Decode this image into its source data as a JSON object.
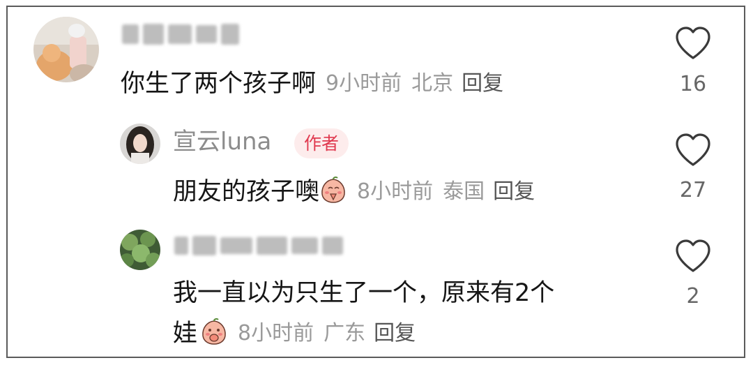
{
  "comments": [
    {
      "text": "你生了两个孩子啊",
      "time": "9小时前",
      "location": "北京",
      "reply_label": "回复",
      "likes": "16"
    },
    {
      "username": "宣云luna",
      "badge": "作者",
      "text": "朋友的孩子噢",
      "time": "8小时前",
      "location": "泰国",
      "reply_label": "回复",
      "likes": "27"
    },
    {
      "text_line1": "我一直以为只生了一个，原来有2个",
      "text_line2": "娃",
      "time": "8小时前",
      "location": "广东",
      "reply_label": "回复",
      "likes": "2"
    }
  ],
  "icons": {
    "like": "heart-outline-icon",
    "emoji": "peach-praying-emoji"
  },
  "colors": {
    "author_badge_bg": "#fdecec",
    "author_badge_text": "#e0394f",
    "meta_text": "#9a9a9a"
  }
}
